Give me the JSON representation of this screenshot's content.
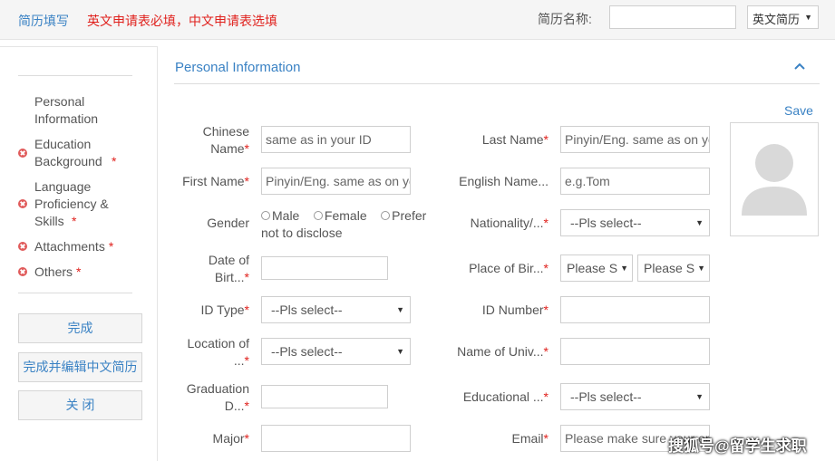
{
  "topbar": {
    "title": "简历填写",
    "notice": "英文申请表必填，中文申请表选填",
    "name_label": "简历名称:",
    "name_value": "",
    "lang_select": "英文简历"
  },
  "sidebar": {
    "items": [
      {
        "label": "Personal Information",
        "required": false
      },
      {
        "label": "Education Background",
        "required": true
      },
      {
        "label": "Language Proficiency & Skills",
        "required": true
      },
      {
        "label": "Attachments",
        "required": true
      },
      {
        "label": "Others",
        "required": true
      }
    ],
    "buttons": {
      "finish": "完成",
      "finish_edit_cn": "完成并编辑中文简历",
      "close": "关 闭"
    },
    "required_mark": "*"
  },
  "section": {
    "title": "Personal Information",
    "save": "Save"
  },
  "form": {
    "required_mark": "*",
    "chinese_name": {
      "label": "Chinese Name",
      "placeholder": "same as in your ID"
    },
    "last_name": {
      "label": "Last Name",
      "placeholder": "Pinyin/Eng. same as on your passport"
    },
    "first_name": {
      "label": "First Name",
      "placeholder": "Pinyin/Eng. same as on your passport"
    },
    "english_name": {
      "label": "English Name...",
      "placeholder": "e.g.Tom"
    },
    "gender": {
      "label": "Gender",
      "options": [
        "Male",
        "Female",
        "Prefer not to disclose"
      ]
    },
    "nationality": {
      "label": "Nationality/...",
      "value": "--Pls select--"
    },
    "date_of_birth": {
      "label": "Date of Birt...",
      "value": ""
    },
    "place_of_birth": {
      "label": "Place of Bir...",
      "value1": "Please Select",
      "value2": "Please Select"
    },
    "id_type": {
      "label": "ID Type",
      "value": "--Pls select--"
    },
    "id_number": {
      "label": "ID Number",
      "value": ""
    },
    "location_of": {
      "label": "Location of ...",
      "value": "--Pls select--"
    },
    "name_of_univ": {
      "label": "Name of Univ...",
      "value": ""
    },
    "graduation_date": {
      "label": "Graduation D...",
      "value": ""
    },
    "educational": {
      "label": "Educational ...",
      "value": "--Pls select--"
    },
    "major": {
      "label": "Major",
      "value": ""
    },
    "email": {
      "label": "Email",
      "placeholder": "Please make sure your email is valid"
    }
  },
  "watermark": "搜狐号@留学生求职"
}
